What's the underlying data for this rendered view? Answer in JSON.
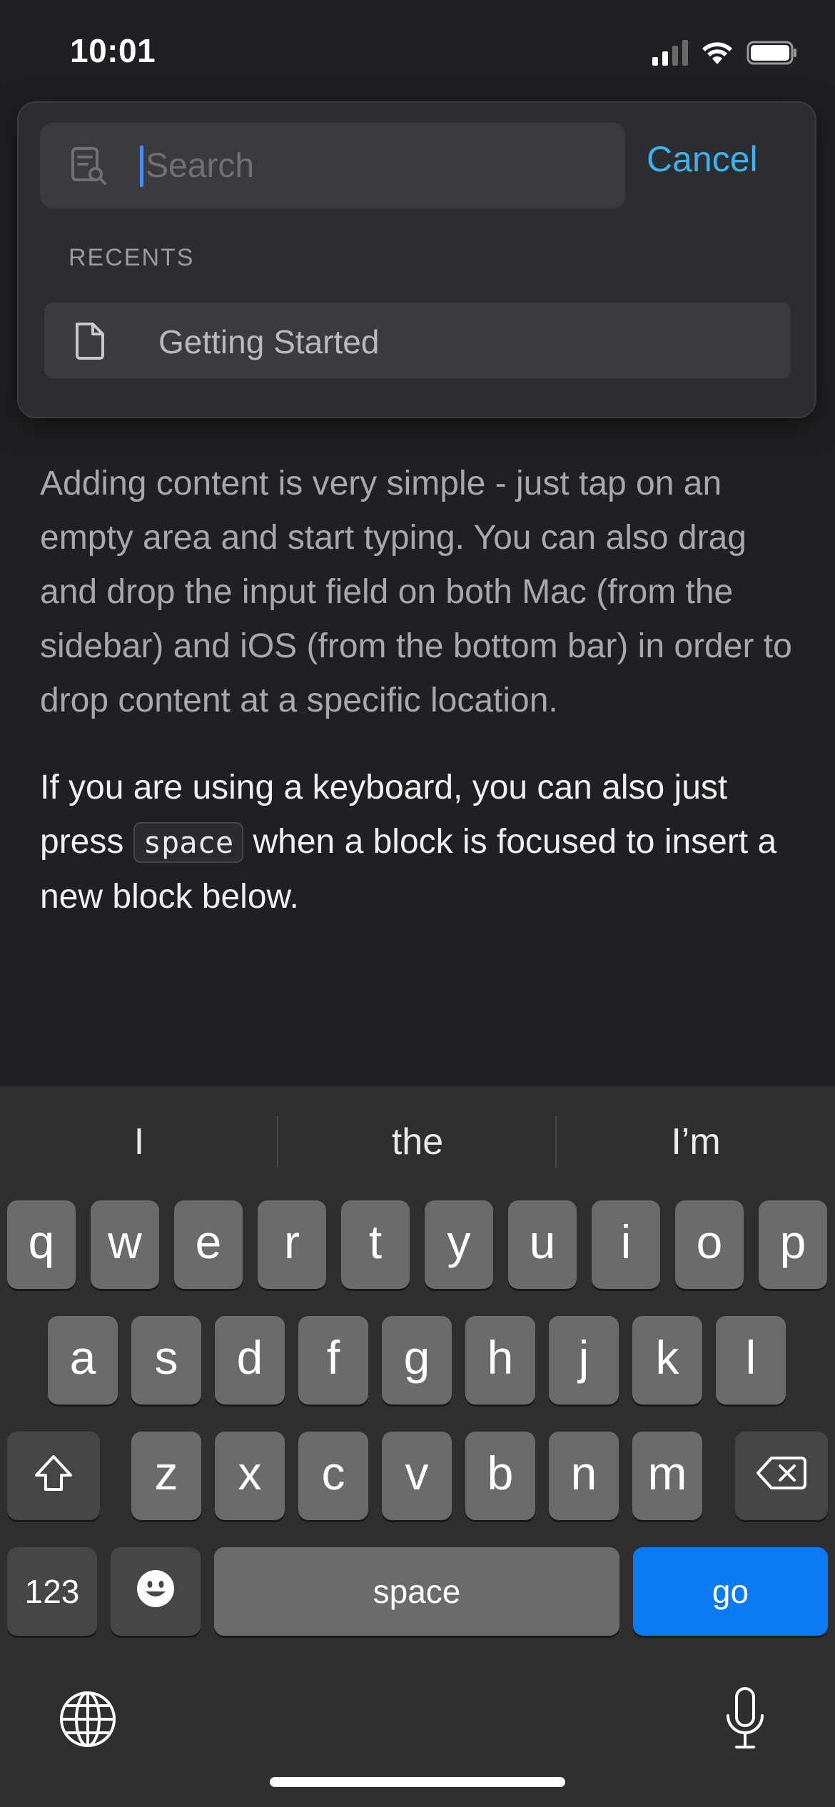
{
  "status_bar": {
    "time": "10:01",
    "icons": [
      "cellular-signal-icon",
      "wifi-icon",
      "battery-icon"
    ]
  },
  "search": {
    "placeholder": "Search",
    "value": "",
    "cancel_label": "Cancel",
    "recents_header": "RECENTS",
    "recents": [
      {
        "label": "Getting Started",
        "icon": "document-icon"
      }
    ]
  },
  "document": {
    "paragraph_1": "Adding content is very simple - just tap on an empty area and start typing. You can also drag and drop the input field on both Mac (from the sidebar) and iOS (from the bottom bar) in order to drop content at a specific location.",
    "paragraph_2_before": "If you are using a keyboard, you can also just press ",
    "paragraph_2_code": "space",
    "paragraph_2_after": " when a block is focused to insert a new block below."
  },
  "keyboard": {
    "suggestions": [
      "I",
      "the",
      "I’m"
    ],
    "row1": [
      "q",
      "w",
      "e",
      "r",
      "t",
      "y",
      "u",
      "i",
      "o",
      "p"
    ],
    "row2": [
      "a",
      "s",
      "d",
      "f",
      "g",
      "h",
      "j",
      "k",
      "l"
    ],
    "row3": [
      "z",
      "x",
      "c",
      "v",
      "b",
      "n",
      "m"
    ],
    "numbers_label": "123",
    "space_label": "space",
    "go_label": "go",
    "icons": [
      "shift-icon",
      "delete-icon",
      "emoji-icon",
      "globe-icon",
      "microphone-icon"
    ]
  },
  "colors": {
    "accent": "#3ab3f0",
    "go_key": "#0a7bf2",
    "caret": "#4a8cf6",
    "background": "#1f2023"
  }
}
